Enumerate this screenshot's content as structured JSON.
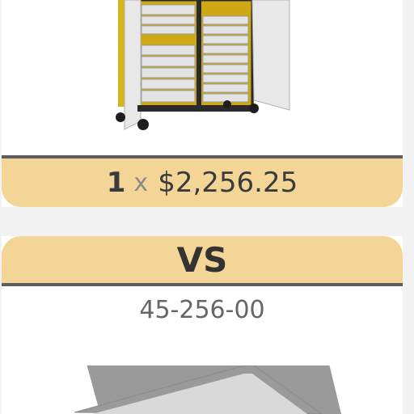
{
  "comparison": {
    "first": {
      "quantity": "1",
      "times": "x",
      "price": "$2,256.25",
      "image_icon": "mobile-storage-cabinet-image"
    },
    "vs_label": "VS",
    "second": {
      "sku": "45-256-00",
      "image_icon": "storage-tray-image"
    },
    "colors": {
      "accent": "#f3d598",
      "rule": "#5e5e5e",
      "cabinet_yellow": "#d8b41c"
    }
  }
}
